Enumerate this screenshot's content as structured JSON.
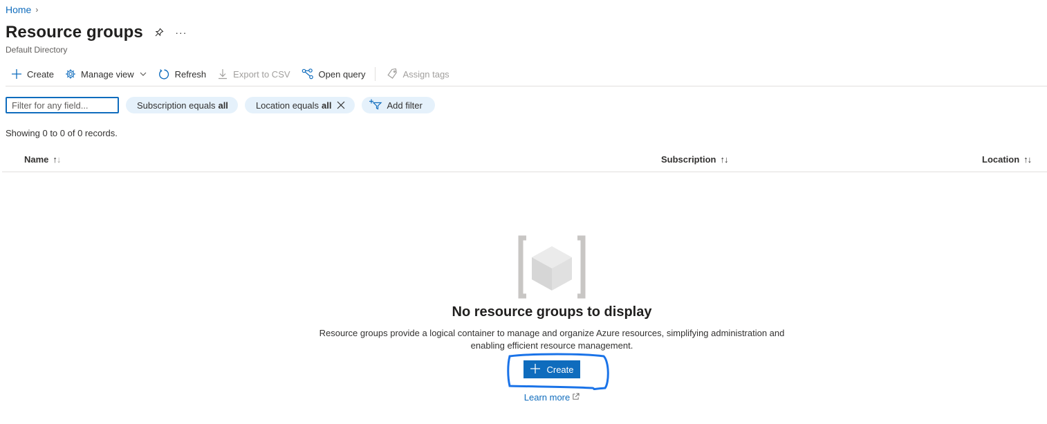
{
  "breadcrumb": {
    "home": "Home",
    "chevron": "›"
  },
  "header": {
    "title": "Resource groups",
    "subtitle": "Default Directory",
    "pin_icon": "pin-icon",
    "more_icon": "more-icon",
    "more_label": "···"
  },
  "toolbar": {
    "create": "Create",
    "manage_view": "Manage view",
    "refresh": "Refresh",
    "export_csv": "Export to CSV",
    "open_query": "Open query",
    "assign_tags": "Assign tags"
  },
  "filters": {
    "search_placeholder": "Filter for any field...",
    "subscription_label": "Subscription equals",
    "subscription_value": "all",
    "location_label": "Location equals",
    "location_value": "all",
    "add_filter": "Add filter"
  },
  "records_text": "Showing 0 to 0 of 0 records.",
  "table": {
    "columns": [
      "Name",
      "Subscription",
      "Location"
    ]
  },
  "empty_state": {
    "title": "No resource groups to display",
    "description": "Resource groups provide a logical container to manage and organize Azure resources, simplifying administration and enabling efficient resource management.",
    "create_label": "Create",
    "learn_more": "Learn more"
  },
  "colors": {
    "accent": "#0f6cbd",
    "pill_bg": "#e5f1fb",
    "highlight_annotation": "#1a73e8"
  }
}
